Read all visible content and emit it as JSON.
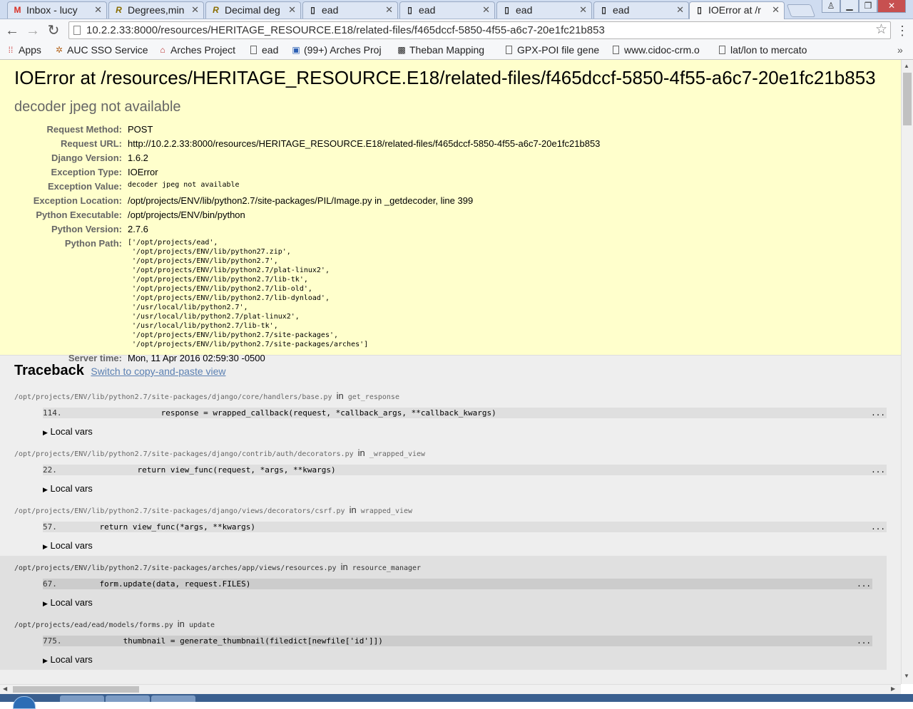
{
  "browser": {
    "tabs": [
      {
        "label": "Inbox - lucy",
        "icon": "gmail-icon",
        "icon_char": "M",
        "icon_color": "#d93025"
      },
      {
        "label": "Degrees,min",
        "icon": "r-logo-icon",
        "icon_char": "R",
        "icon_color": "#8a6d00"
      },
      {
        "label": "Decimal deg",
        "icon": "r-logo-icon",
        "icon_char": "R",
        "icon_color": "#8a6d00"
      },
      {
        "label": "ead",
        "icon": "page-icon"
      },
      {
        "label": "ead",
        "icon": "page-icon"
      },
      {
        "label": "ead",
        "icon": "page-icon"
      },
      {
        "label": "ead",
        "icon": "page-icon"
      },
      {
        "label": "IOError at /r",
        "icon": "page-icon",
        "active": true
      }
    ],
    "url": "10.2.2.33:8000/resources/HERITAGE_RESOURCE.E18/related-files/f465dccf-5850-4f55-a6c7-20e1fc21b853",
    "bookmarks": [
      {
        "label": "Apps",
        "icon": "apps-grid-icon"
      },
      {
        "label": "AUC SSO Service",
        "icon": "auc-icon"
      },
      {
        "label": "Arches Project",
        "icon": "arches-icon"
      },
      {
        "label": "ead",
        "icon": "page-icon"
      },
      {
        "label": "(99+) Arches Proj",
        "icon": "google-groups-icon"
      },
      {
        "label": "Theban Mapping",
        "icon": "theban-icon"
      },
      {
        "label": "GPX-POI file gene",
        "icon": "page-icon"
      },
      {
        "label": "www.cidoc-crm.o",
        "icon": "page-icon"
      },
      {
        "label": "lat/lon to mercato",
        "icon": "page-icon"
      }
    ]
  },
  "error": {
    "title": "IOError at /resources/HERITAGE_RESOURCE.E18/related-files/f465dccf-5850-4f55-a6c7-20e1fc21b853",
    "value": "decoder jpeg not available",
    "meta": [
      {
        "label": "Request Method:",
        "value": "POST"
      },
      {
        "label": "Request URL:",
        "value": "http://10.2.2.33:8000/resources/HERITAGE_RESOURCE.E18/related-files/f465dccf-5850-4f55-a6c7-20e1fc21b853"
      },
      {
        "label": "Django Version:",
        "value": "1.6.2"
      },
      {
        "label": "Exception Type:",
        "value": "IOError"
      },
      {
        "label": "Exception Value:",
        "value": "decoder jpeg not available",
        "mono": true
      },
      {
        "label": "Exception Location:",
        "value": "/opt/projects/ENV/lib/python2.7/site-packages/PIL/Image.py in _getdecoder, line 399"
      },
      {
        "label": "Python Executable:",
        "value": "/opt/projects/ENV/bin/python"
      },
      {
        "label": "Python Version:",
        "value": "2.7.6"
      }
    ],
    "python_path_label": "Python Path:",
    "python_path": "['/opt/projects/ead',\n '/opt/projects/ENV/lib/python27.zip',\n '/opt/projects/ENV/lib/python2.7',\n '/opt/projects/ENV/lib/python2.7/plat-linux2',\n '/opt/projects/ENV/lib/python2.7/lib-tk',\n '/opt/projects/ENV/lib/python2.7/lib-old',\n '/opt/projects/ENV/lib/python2.7/lib-dynload',\n '/usr/local/lib/python2.7',\n '/usr/local/lib/python2.7/plat-linux2',\n '/usr/local/lib/python2.7/lib-tk',\n '/opt/projects/ENV/lib/python2.7/site-packages',\n '/opt/projects/ENV/lib/python2.7/site-packages/arches']",
    "server_time_label": "Server time:",
    "server_time": "Mon, 11 Apr 2016 02:59:30 -0500"
  },
  "traceback": {
    "heading": "Traceback",
    "switch_link": "Switch to copy-and-paste view",
    "in_word": "in",
    "local_vars_label": "Local vars",
    "frames": [
      {
        "file": "/opt/projects/ENV/lib/python2.7/site-packages/django/core/handlers/base.py",
        "func": "get_response",
        "line": "114.",
        "code": "                    response = wrapped_callback(request, *callback_args, **callback_kwargs)",
        "user": false
      },
      {
        "file": "/opt/projects/ENV/lib/python2.7/site-packages/django/contrib/auth/decorators.py",
        "func": "_wrapped_view",
        "line": "22.",
        "code": "                return view_func(request, *args, **kwargs)",
        "user": false
      },
      {
        "file": "/opt/projects/ENV/lib/python2.7/site-packages/django/views/decorators/csrf.py",
        "func": "wrapped_view",
        "line": "57.",
        "code": "        return view_func(*args, **kwargs)",
        "user": false
      },
      {
        "file": "/opt/projects/ENV/lib/python2.7/site-packages/arches/app/views/resources.py",
        "func": "resource_manager",
        "line": "67.",
        "code": "        form.update(data, request.FILES)",
        "user": true
      },
      {
        "file": "/opt/projects/ead/ead/models/forms.py",
        "func": "update",
        "line": "775.",
        "code": "            thumbnail = generate_thumbnail(filedict[newfile['id']])",
        "user": true
      }
    ],
    "ellipsis": "..."
  }
}
